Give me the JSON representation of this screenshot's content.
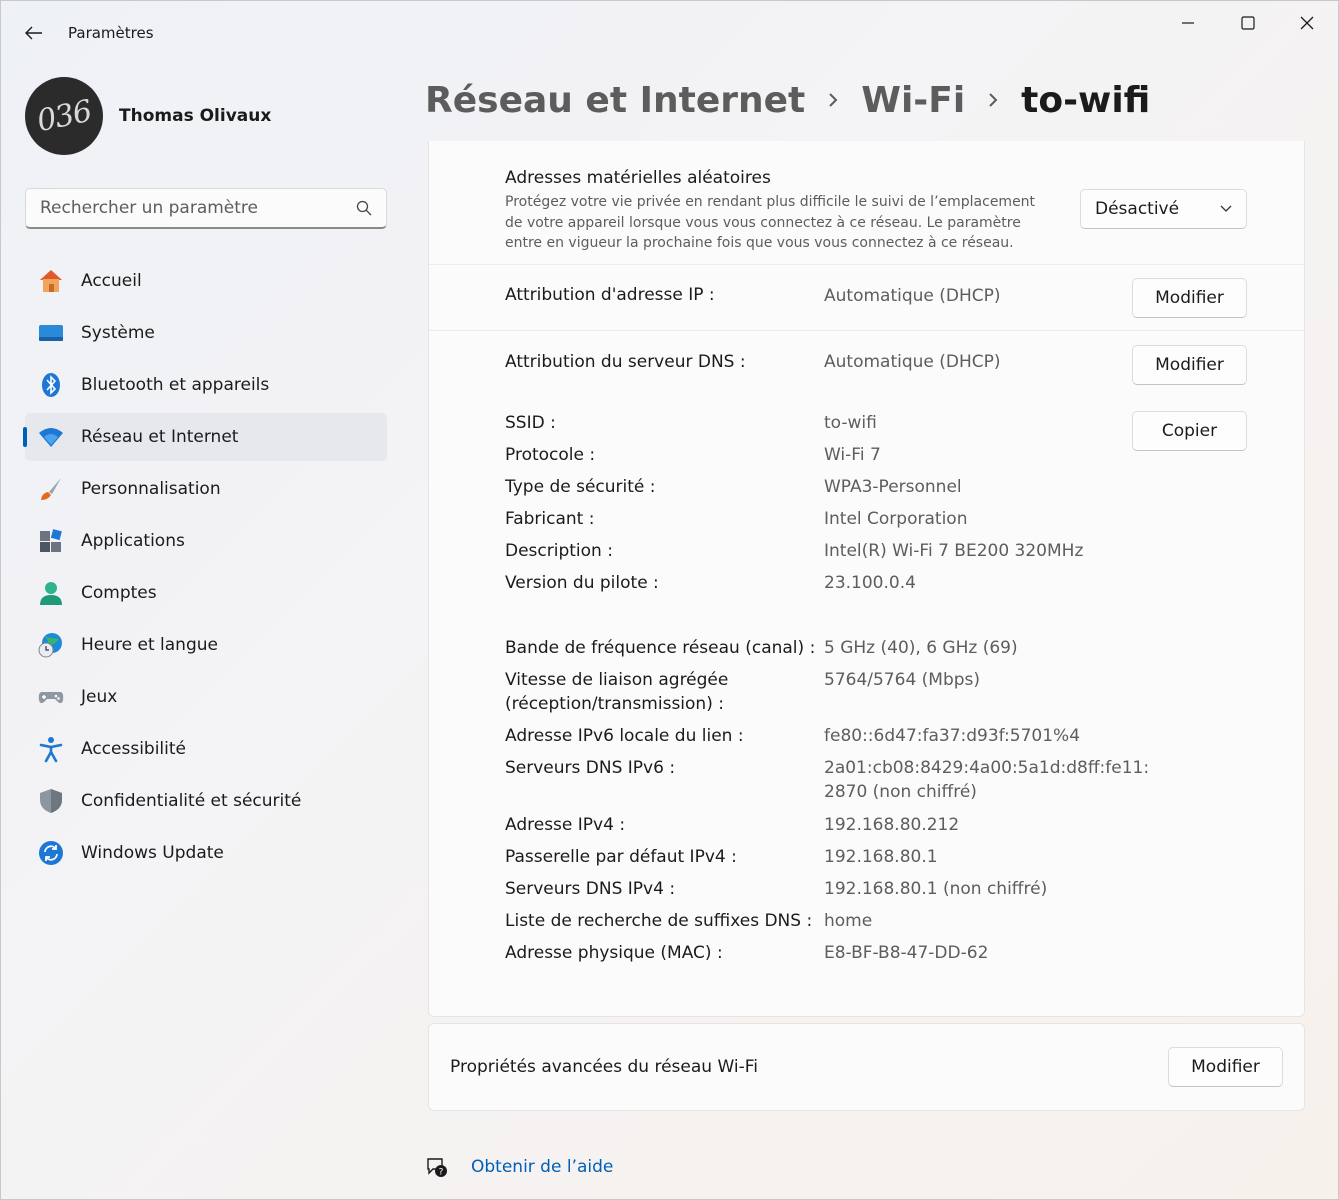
{
  "app": {
    "title": "Paramètres"
  },
  "user": {
    "name": "Thomas Olivaux",
    "avatar_text": "036"
  },
  "search": {
    "placeholder": "Rechercher un paramètre"
  },
  "sidebar": {
    "items": [
      {
        "label": "Accueil",
        "icon": "home-icon"
      },
      {
        "label": "Système",
        "icon": "display-icon"
      },
      {
        "label": "Bluetooth et appareils",
        "icon": "bluetooth-icon"
      },
      {
        "label": "Réseau et Internet",
        "icon": "wifi-icon",
        "active": true
      },
      {
        "label": "Personnalisation",
        "icon": "brush-icon"
      },
      {
        "label": "Applications",
        "icon": "apps-icon"
      },
      {
        "label": "Comptes",
        "icon": "person-icon"
      },
      {
        "label": "Heure et langue",
        "icon": "globe-clock-icon"
      },
      {
        "label": "Jeux",
        "icon": "gamepad-icon"
      },
      {
        "label": "Accessibilité",
        "icon": "accessibility-icon"
      },
      {
        "label": "Confidentialité et sécurité",
        "icon": "shield-icon"
      },
      {
        "label": "Windows Update",
        "icon": "update-icon"
      }
    ]
  },
  "breadcrumb": [
    "Réseau et Internet",
    "Wi-Fi",
    "to-wifi"
  ],
  "random_mac": {
    "title": "Adresses matérielles aléatoires",
    "description": "Protégez votre vie privée en rendant plus difficile le suivi de l’emplacement de votre appareil lorsque vous vous connectez à ce réseau. Le paramètre entre en vigueur la prochaine fois que vous vous connectez à ce réseau.",
    "value": "Désactivé"
  },
  "ip_assignment": {
    "label": "Attribution d'adresse IP :",
    "value": "Automatique (DHCP)",
    "button": "Modifier"
  },
  "dns_assignment": {
    "label": "Attribution du serveur DNS :",
    "value": "Automatique (DHCP)",
    "button": "Modifier"
  },
  "copy_button": "Copier",
  "properties": {
    "ssid": {
      "label": "SSID :",
      "value": "to-wifi"
    },
    "protocol": {
      "label": "Protocole :",
      "value": "Wi-Fi 7"
    },
    "security": {
      "label": "Type de sécurité :",
      "value": "WPA3-Personnel"
    },
    "manufacturer": {
      "label": "Fabricant :",
      "value": "Intel Corporation"
    },
    "description": {
      "label": "Description :",
      "value": "Intel(R) Wi-Fi 7 BE200 320MHz"
    },
    "driver": {
      "label": "Version du pilote :",
      "value": "23.100.0.4"
    },
    "band": {
      "label": "Bande de fréquence réseau (canal) :",
      "value": "5 GHz (40), 6 GHz (69)"
    },
    "link_speed": {
      "label_1": "Vitesse de liaison agrégée",
      "label_2": "(réception/transmission) :",
      "value": "5764/5764 (Mbps)"
    },
    "ipv6_local": {
      "label": "Adresse IPv6 locale du lien :",
      "value": "fe80::6d47:fa37:d93f:5701%4"
    },
    "ipv6_dns": {
      "label": "Serveurs DNS IPv6 :",
      "value_1": "2a01:cb08:8429:4a00:5a1d:d8ff:fe11:",
      "value_2": "2870 (non chiffré)"
    },
    "ipv4": {
      "label": "Adresse IPv4 :",
      "value": "192.168.80.212"
    },
    "gateway": {
      "label": "Passerelle par défaut IPv4 :",
      "value": "192.168.80.1"
    },
    "ipv4_dns": {
      "label": "Serveurs DNS IPv4 :",
      "value": "192.168.80.1 (non chiffré)"
    },
    "dns_suffix": {
      "label": "Liste de recherche de suffixes DNS :",
      "value": "home"
    },
    "mac": {
      "label": "Adresse physique (MAC) :",
      "value": "E8-BF-B8-47-DD-62"
    }
  },
  "advanced": {
    "label": "Propriétés avancées du réseau Wi-Fi",
    "button": "Modifier"
  },
  "help": {
    "label": "Obtenir de l’aide"
  },
  "colors": {
    "accent": "#005fb8",
    "active_nav_bg": "#e6e8ed"
  }
}
